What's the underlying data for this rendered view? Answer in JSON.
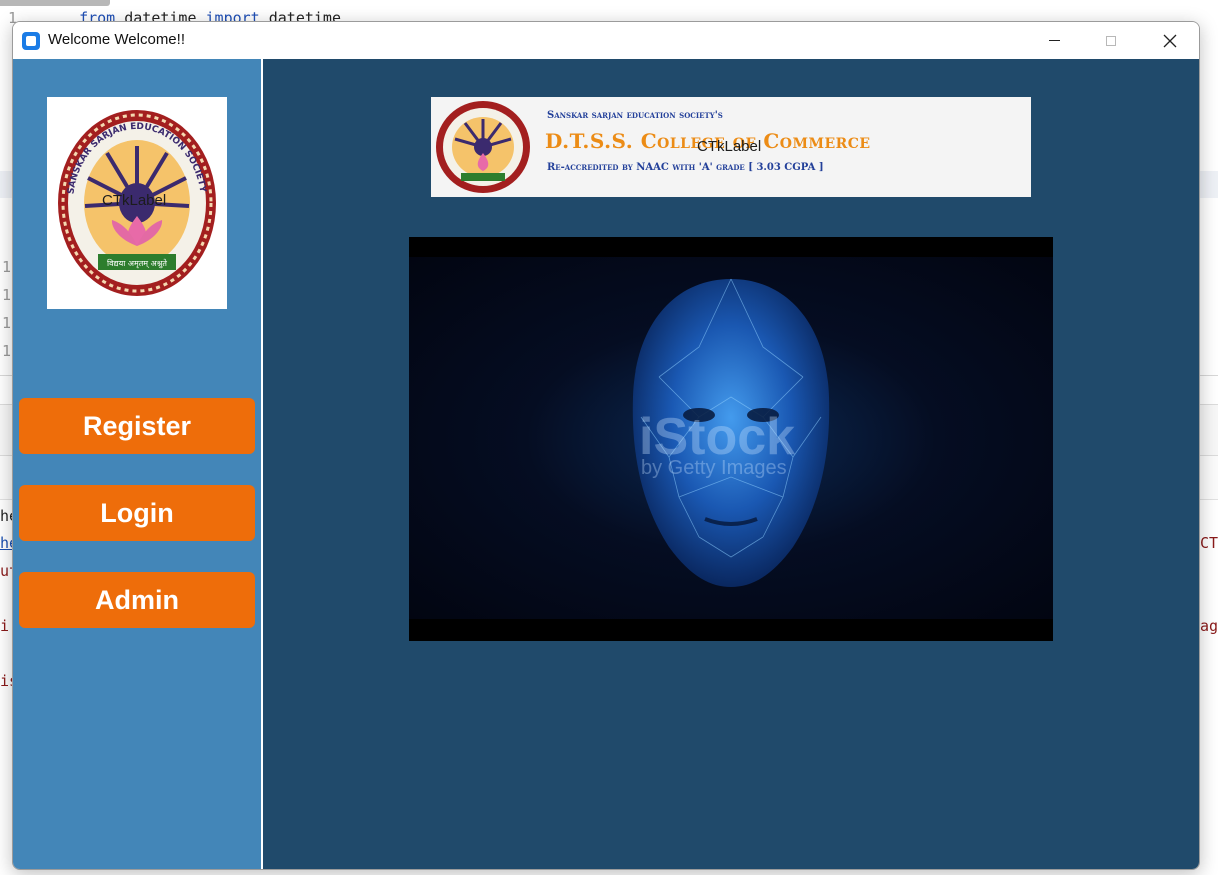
{
  "background_editor": {
    "line1": {
      "number": "1",
      "keyword_from": "from",
      "module": "datetime",
      "keyword_import": "import",
      "name": "datetime"
    },
    "gutter_numbers": [
      "1",
      "1",
      "1",
      "1"
    ],
    "console_fragments": [
      "he",
      "he",
      "ut",
      "i",
      "is",
      "CT",
      "ag"
    ]
  },
  "window": {
    "title": "Welcome Welcome!!",
    "close_glyph": "✕"
  },
  "sidebar": {
    "logo_label": "CTkLabel",
    "logo_ring_text": "SANSKAR SARJAN EDUCATION SOCIETY",
    "logo_motto": "विद्यया अमृतम् अश्नुते",
    "buttons": {
      "register": "Register",
      "login": "Login",
      "admin": "Admin"
    }
  },
  "main": {
    "banner": {
      "label": "CTkLabel",
      "society": "Sanskar sarjan education society's",
      "college": "D.T.S.S. College of Commerce",
      "accreditation": "Re-accredited by NAAC with 'A' grade [ 3.03 CGPA ]"
    },
    "media": {
      "watermark_brand": "iStock",
      "watermark_sub": "by Getty Images"
    }
  },
  "colors": {
    "sidebar": "#4386b8",
    "main": "#204a6b",
    "button": "#ee6d0a",
    "banner_title": "#ec8c16"
  }
}
